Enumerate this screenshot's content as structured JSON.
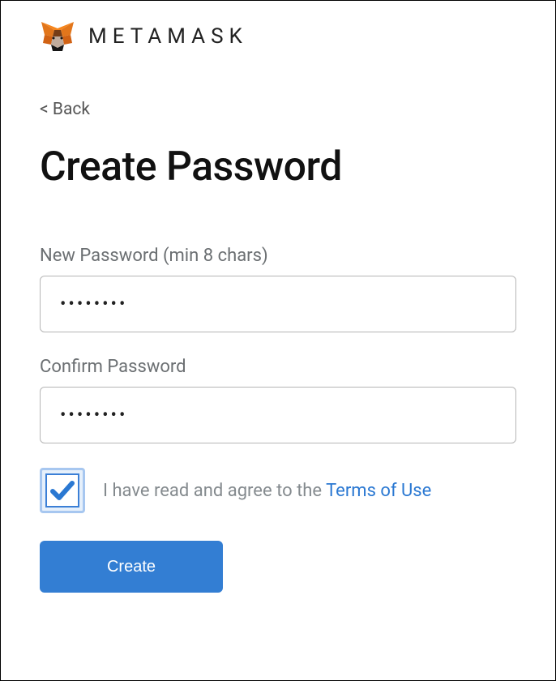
{
  "header": {
    "brand": "METAMASK"
  },
  "nav": {
    "back": "< Back"
  },
  "page": {
    "title": "Create Password"
  },
  "form": {
    "new_password_label": "New Password (min 8 chars)",
    "new_password_value": "••••••••",
    "confirm_password_label": "Confirm Password",
    "confirm_password_value": "••••••••",
    "terms_text": "I have read and agree to the ",
    "terms_link": "Terms of Use",
    "terms_checked": true,
    "create_label": "Create"
  },
  "colors": {
    "accent": "#337ed3",
    "link": "#2a78d2",
    "muted": "#848a8e"
  }
}
